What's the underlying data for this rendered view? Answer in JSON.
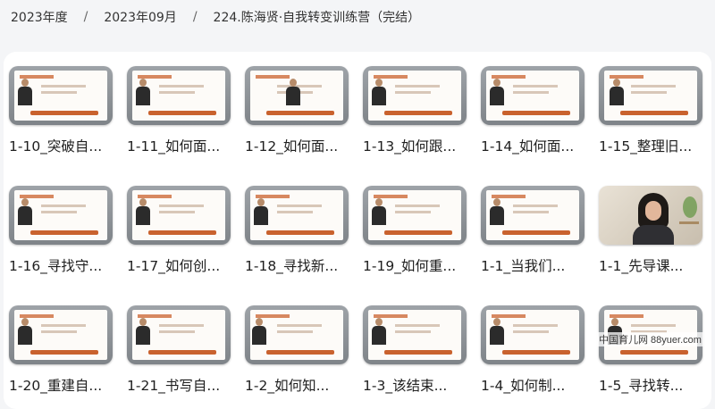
{
  "breadcrumb": [
    "2023年度",
    "2023年09月",
    "224.陈海贤·自我转变训练营（完结）"
  ],
  "breadcrumb_sep": "/",
  "cards": [
    {
      "title": "1-10_突破自..."
    },
    {
      "title": "1-11_如何面..."
    },
    {
      "title": "1-12_如何面..."
    },
    {
      "title": "1-13_如何跟..."
    },
    {
      "title": "1-14_如何面..."
    },
    {
      "title": "1-15_整理旧..."
    },
    {
      "title": "1-16_寻找守..."
    },
    {
      "title": "1-17_如何创..."
    },
    {
      "title": "1-18_寻找新..."
    },
    {
      "title": "1-19_如何重..."
    },
    {
      "title": "1-1_当我们..."
    },
    {
      "title": "1-1_先导课..."
    },
    {
      "title": "1-20_重建自..."
    },
    {
      "title": "1-21_书写自..."
    },
    {
      "title": "1-2_如何知..."
    },
    {
      "title": "1-3_该结束..."
    },
    {
      "title": "1-4_如何制..."
    },
    {
      "title": "1-5_寻找转..."
    }
  ],
  "watermark": "中国育儿网 88yuer.com",
  "colors": {
    "accent": "#c9622e",
    "background": "#f4f5f7",
    "panel": "#ffffff"
  }
}
